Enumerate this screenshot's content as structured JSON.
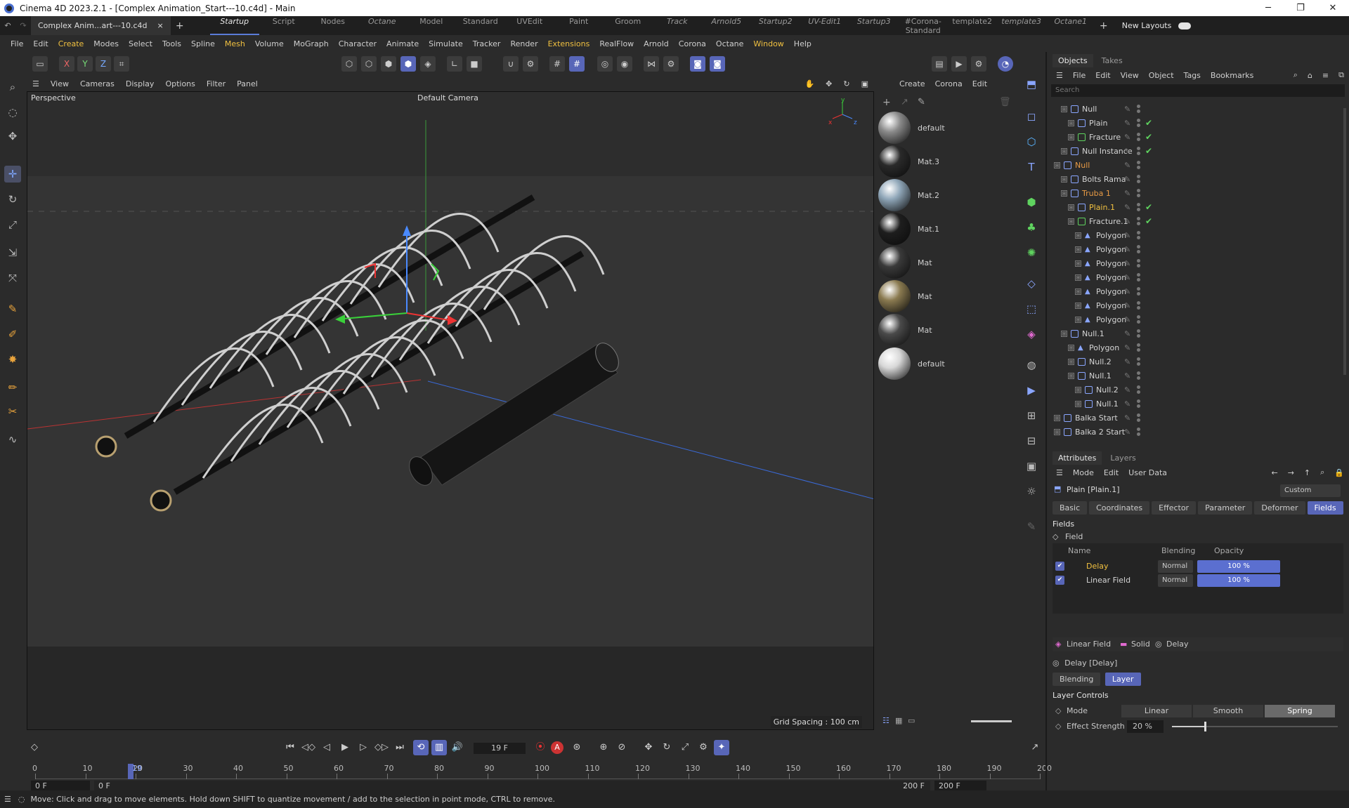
{
  "title_bar": {
    "title": "Cinema 4D 2023.2.1 - [Complex Animation_Start---10.c4d] - Main",
    "buttons": [
      "─",
      "❐",
      "✕"
    ]
  },
  "doc_tab": {
    "label": "Complex Anim...art---10.c4d",
    "close": "×",
    "add": "+"
  },
  "layout_tabs": [
    "Startup",
    "Script",
    "Nodes",
    "Octane",
    "Model",
    "Standard",
    "UVEdit",
    "Paint",
    "Groom",
    "Track",
    "Arnold5",
    "Startup2",
    "UV-Edit1",
    "Startup3",
    "#Corona-Standard",
    "template2",
    "template3",
    "Octane1"
  ],
  "layout_tabs_add": "+",
  "new_layouts": "New Layouts",
  "main_menu": [
    "File",
    "Edit",
    "Create",
    "Modes",
    "Select",
    "Tools",
    "Spline",
    "Mesh",
    "Volume",
    "MoGraph",
    "Character",
    "Animate",
    "Simulate",
    "Tracker",
    "Render",
    "Extensions",
    "RealFlow",
    "Arnold",
    "Corona",
    "Octane",
    "Window",
    "Help"
  ],
  "toolbar": {
    "x_label": "X",
    "y_label": "Y",
    "z_label": "Z"
  },
  "viewport": {
    "menu": [
      "View",
      "Cameras",
      "Display",
      "Options",
      "Filter",
      "Panel"
    ],
    "label": "Perspective",
    "camera": "Default Camera",
    "grid_spacing": "Grid Spacing : 100 cm",
    "axis_x": "x",
    "axis_y": "y",
    "axis_z": "z"
  },
  "material_panel": {
    "menu": [
      "Create",
      "Corona",
      "Edit"
    ],
    "materials": [
      {
        "name": "default",
        "color": "#8a8a8a"
      },
      {
        "name": "Mat.3",
        "color": "#2a2a2a"
      },
      {
        "name": "Mat.2",
        "color": "#8fa6b8"
      },
      {
        "name": "Mat.1",
        "color": "#1e1e1e"
      },
      {
        "name": "Mat",
        "color": "#3a3a3a"
      },
      {
        "name": "Mat",
        "color": "#8a7a50"
      },
      {
        "name": "Mat",
        "color": "#4a4a4a"
      },
      {
        "name": "default",
        "color": "#d8d8d8"
      }
    ]
  },
  "objects_panel": {
    "tabs": [
      "Objects",
      "Takes"
    ],
    "menu": [
      "File",
      "Edit",
      "View",
      "Object",
      "Tags",
      "Bookmarks"
    ],
    "search_placeholder": "Search",
    "rows": [
      {
        "name": "Null",
        "indent": 1,
        "style": "",
        "check": false
      },
      {
        "name": "Plain",
        "indent": 2,
        "style": "",
        "check": true
      },
      {
        "name": "Fracture",
        "indent": 2,
        "style": "",
        "check": true
      },
      {
        "name": "Null Instance",
        "indent": 1,
        "style": "",
        "check": true
      },
      {
        "name": "Null",
        "indent": 0,
        "style": "orange",
        "check": false
      },
      {
        "name": "Bolts Rama",
        "indent": 1,
        "style": "",
        "check": false
      },
      {
        "name": "Truba 1",
        "indent": 1,
        "style": "orange",
        "check": false
      },
      {
        "name": "Plain.1",
        "indent": 2,
        "style": "yellow",
        "check": true
      },
      {
        "name": "Fracture.1",
        "indent": 2,
        "style": "",
        "check": true
      },
      {
        "name": "Polygon",
        "indent": 3,
        "style": "",
        "check": false
      },
      {
        "name": "Polygon",
        "indent": 3,
        "style": "",
        "check": false
      },
      {
        "name": "Polygon",
        "indent": 3,
        "style": "",
        "check": false
      },
      {
        "name": "Polygon",
        "indent": 3,
        "style": "",
        "check": false
      },
      {
        "name": "Polygon",
        "indent": 3,
        "style": "",
        "check": false
      },
      {
        "name": "Polygon",
        "indent": 3,
        "style": "",
        "check": false
      },
      {
        "name": "Polygon",
        "indent": 3,
        "style": "",
        "check": false
      },
      {
        "name": "Null.1",
        "indent": 1,
        "style": "",
        "check": false
      },
      {
        "name": "Polygon",
        "indent": 2,
        "style": "",
        "check": false
      },
      {
        "name": "Null.2",
        "indent": 2,
        "style": "",
        "check": false
      },
      {
        "name": "Null.1",
        "indent": 2,
        "style": "",
        "check": false
      },
      {
        "name": "Null.2",
        "indent": 3,
        "style": "",
        "check": false
      },
      {
        "name": "Null.1",
        "indent": 3,
        "style": "",
        "check": false
      },
      {
        "name": "Balka Start",
        "indent": 0,
        "style": "",
        "check": false
      },
      {
        "name": "Balka 2 Start",
        "indent": 0,
        "style": "",
        "check": false
      }
    ],
    "check_glyph": "✔"
  },
  "attributes_panel": {
    "tabs": [
      "Attributes",
      "Layers"
    ],
    "menu": [
      "Mode",
      "Edit",
      "User Data"
    ],
    "object_name": "Plain [Plain.1]",
    "preset": "Custom",
    "sub_tabs": [
      "Basic",
      "Coordinates",
      "Effector",
      "Parameter",
      "Deformer",
      "Fields"
    ],
    "section": "Fields",
    "field_label": "Field",
    "columns": {
      "name": "Name",
      "blending": "Blending",
      "opacity": "Opacity"
    },
    "fields": [
      {
        "name": "Delay",
        "blending": "Normal",
        "opacity": "100 %",
        "opacity_value": 100,
        "highlight": true
      },
      {
        "name": "Linear Field",
        "blending": "Normal",
        "opacity": "100 %",
        "opacity_value": 100,
        "highlight": false
      }
    ],
    "bottom_bar": [
      "Linear Field",
      "Solid",
      "Delay"
    ],
    "sub_object": "Delay [Delay]",
    "sub_tabs2": [
      "Blending",
      "Layer"
    ],
    "layer_controls": "Layer Controls",
    "mode_label": "Mode",
    "modes": [
      "Linear",
      "Smooth",
      "Spring"
    ],
    "active_mode": "Spring",
    "effect_strength_label": "Effect Strength",
    "effect_strength": "20 %",
    "effect_strength_value": 20
  },
  "timeline": {
    "current_frame": "19 F",
    "ruler_ticks": [
      "0",
      "10",
      "20",
      "30",
      "40",
      "50",
      "60",
      "70",
      "80",
      "90",
      "100",
      "110",
      "120",
      "130",
      "140",
      "150",
      "160",
      "170",
      "180",
      "190",
      "200"
    ],
    "playhead": "19",
    "playhead_value": 19,
    "range_max": 200,
    "start_a": "0 F",
    "start_b": "0 F",
    "end_a": "200 F",
    "end_b": "200 F",
    "rec_a": "A"
  },
  "status": {
    "text": "Move: Click and drag to move elements. Hold down SHIFT to quantize movement / add to the selection in point mode, CTRL to remove."
  }
}
